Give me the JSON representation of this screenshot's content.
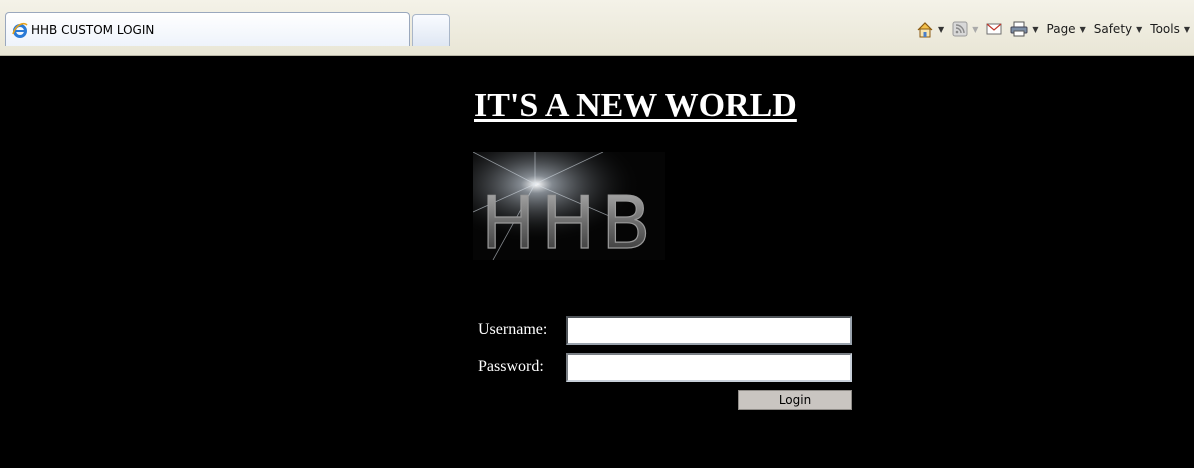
{
  "browser": {
    "tab_title": "HHB CUSTOM LOGIN",
    "commands": {
      "page": "Page",
      "safety": "Safety",
      "tools": "Tools"
    },
    "icons": [
      "home-icon",
      "rss-feed-icon",
      "read-mail-icon",
      "print-icon"
    ]
  },
  "page": {
    "headline": "IT'S A NEW WORLD",
    "logo_text": "HHB",
    "form": {
      "username_label": "Username:",
      "username_value": "",
      "password_label": "Password:",
      "password_value": "",
      "login_label": "Login"
    }
  },
  "colors": {
    "page_background": "#000000",
    "text": "#ffffff",
    "button": "#c9c5c1"
  }
}
